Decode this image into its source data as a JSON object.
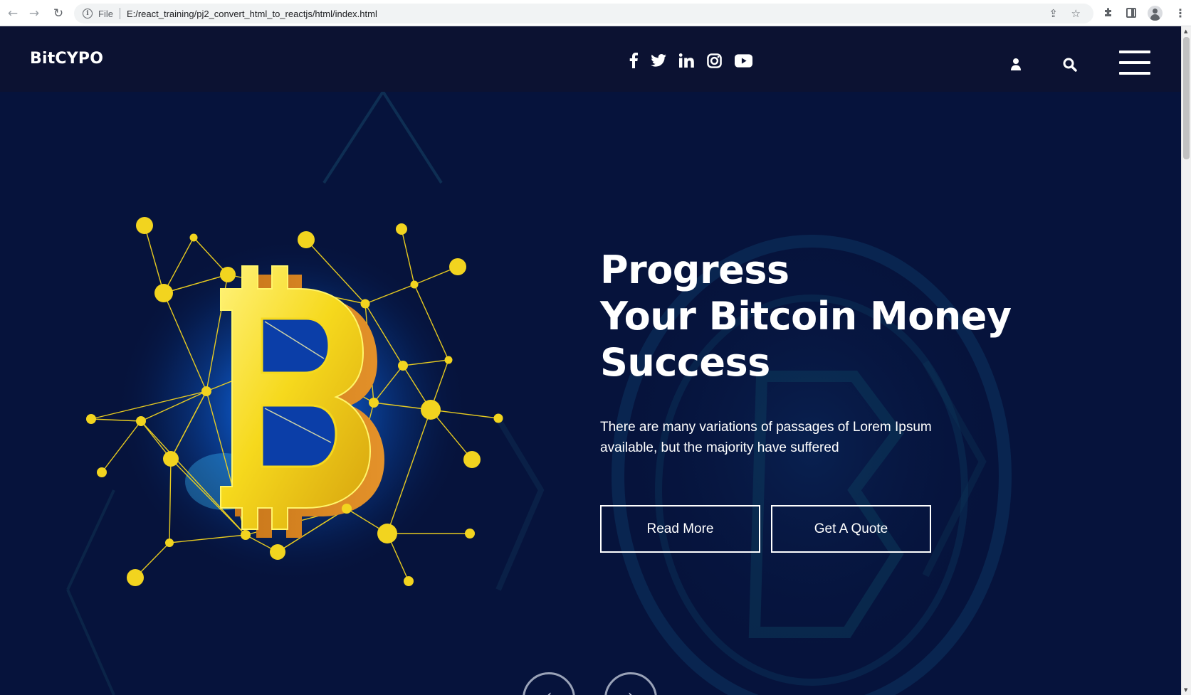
{
  "browser": {
    "scheme_label": "File",
    "url": "E:/react_training/pj2_convert_html_to_reactjs/html/index.html",
    "icons": [
      "back-icon",
      "forward-icon",
      "reload-icon",
      "info-icon",
      "share-icon",
      "star-icon",
      "extensions-icon",
      "side-panel-icon",
      "profile-icon",
      "menu-icon"
    ]
  },
  "site": {
    "logo": "BitCYPO",
    "social_icons": [
      "facebook-icon",
      "twitter-icon",
      "linkedin-icon",
      "instagram-icon",
      "youtube-icon"
    ],
    "tool_icons": [
      "user-icon",
      "search-icon",
      "hamburger-menu-icon"
    ]
  },
  "hero": {
    "title_lines": [
      "Progress",
      "Your Bitcoin Money",
      "Success"
    ],
    "text": "There are many variations of passages of Lorem Ipsum available, but the majority have suffered",
    "read_more_label": "Read More",
    "quote_label": "Get A Quote",
    "slider_prev": "‹",
    "slider_next": "›"
  },
  "colors": {
    "header_bg": "#0c1232",
    "hero_bg": "#06123a",
    "gold": "#f2d41f",
    "text": "#ffffff"
  }
}
